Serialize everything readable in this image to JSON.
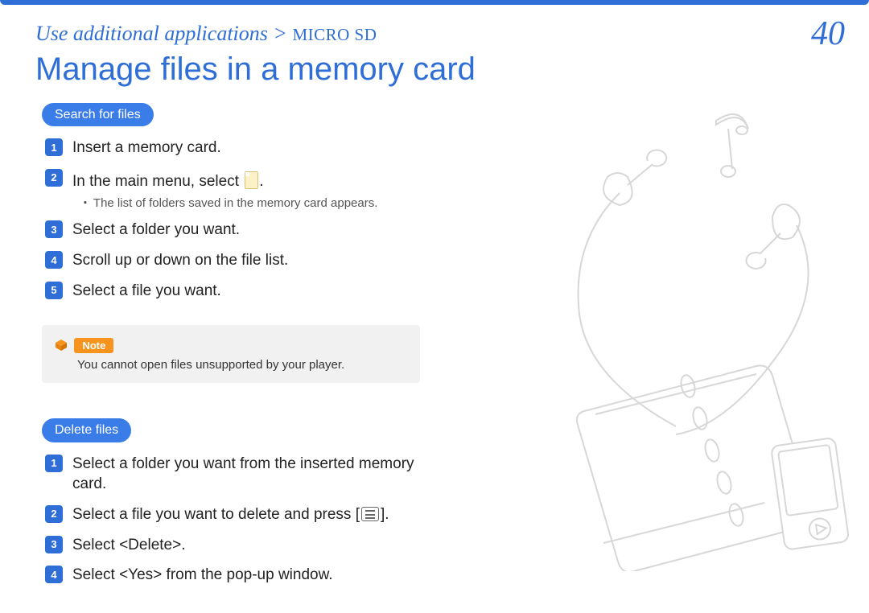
{
  "header": {
    "breadcrumb_part1": "Use additional applications",
    "breadcrumb_separator": " > ",
    "breadcrumb_part2": "MICRO SD",
    "page_number": "40"
  },
  "title": "Manage files in a memory card",
  "sections": [
    {
      "pill": "Search for files",
      "steps": [
        {
          "num": "1",
          "text": "Insert a memory card."
        },
        {
          "num": "2",
          "text_pre": "In the main menu, select ",
          "text_post": ".",
          "has_sdcard_icon": true,
          "sub": "The list of folders saved in the memory card appears."
        },
        {
          "num": "3",
          "text": "Select a folder you want."
        },
        {
          "num": "4",
          "text": "Scroll up or down on the file list."
        },
        {
          "num": "5",
          "text": "Select a file you want."
        }
      ],
      "note": {
        "label": "Note",
        "text": "You cannot open files unsupported by your player."
      }
    },
    {
      "pill": "Delete files",
      "steps": [
        {
          "num": "1",
          "text": "Select a folder you want from the inserted memory card."
        },
        {
          "num": "2",
          "text_pre": "Select a file you want to delete and press [",
          "text_post": "].",
          "has_menu_icon": true
        },
        {
          "num": "3",
          "text": "Select <Delete>."
        },
        {
          "num": "4",
          "text": "Select <Yes> from the pop-up window."
        }
      ]
    }
  ]
}
